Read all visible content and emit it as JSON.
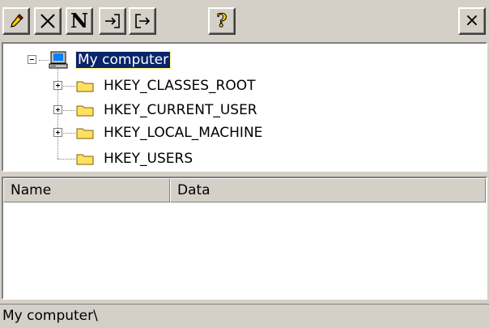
{
  "toolbar": {
    "buttons": [
      {
        "name": "edit-button",
        "icon": "pencil-icon"
      },
      {
        "name": "delete-button",
        "icon": "delete-x-icon"
      },
      {
        "name": "new-button",
        "icon": "new-n-icon",
        "glyph": "N"
      },
      {
        "name": "import-button",
        "icon": "import-icon"
      },
      {
        "name": "export-button",
        "icon": "export-icon"
      },
      {
        "name": "help-button",
        "icon": "help-icon",
        "glyph": "?"
      }
    ],
    "close_glyph": "×"
  },
  "tree": {
    "root": {
      "label": "My computer",
      "icon": "computer-icon",
      "expanded": true,
      "selected": true
    },
    "children": [
      {
        "label": "HKEY_CLASSES_ROOT",
        "icon": "folder-icon",
        "expandable": true
      },
      {
        "label": "HKEY_CURRENT_USER",
        "icon": "folder-icon",
        "expandable": true
      },
      {
        "label": "HKEY_LOCAL_MACHINE",
        "icon": "folder-icon",
        "expandable": true
      },
      {
        "label": "HKEY_USERS",
        "icon": "folder-icon",
        "expandable": false
      }
    ]
  },
  "list": {
    "columns": [
      "Name",
      "Data"
    ],
    "rows": []
  },
  "status_bar": {
    "text": "My computer\\"
  },
  "colors": {
    "selection": "#0a246a",
    "folder": "#ffe060",
    "face": "#d4d0c8"
  }
}
